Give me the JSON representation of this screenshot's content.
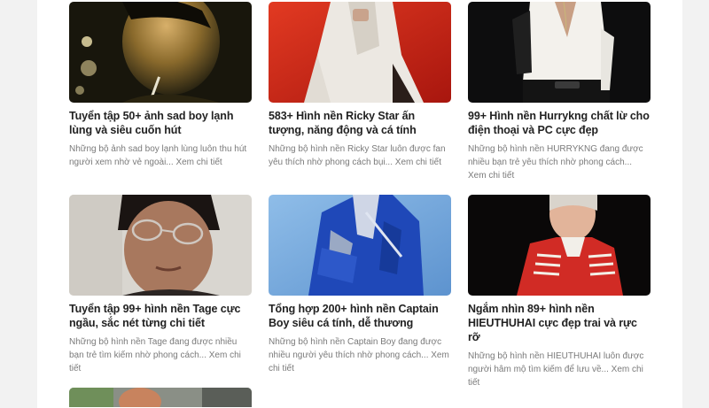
{
  "articles": [
    {
      "title": "Tuyển tập 50+ ảnh sad boy lạnh lùng và siêu cuốn hút",
      "excerpt": "Những bộ ảnh sad boy lạnh lùng luôn thu hút người xem nhờ vẻ ngoài...",
      "more": "Xem chi tiết",
      "image_alt": "sad-boy-portrait"
    },
    {
      "title": "583+ Hình nền Ricky Star ấn tượng, năng động và cá tính",
      "excerpt": "Những bộ hình nền Ricky Star luôn được fan yêu thích nhờ phong cách bụi...",
      "more": "Xem chi tiết",
      "image_alt": "ricky-star-photo"
    },
    {
      "title": "99+ Hình nền Hurrykng chất lừ cho điện thoại và PC cực đẹp",
      "excerpt": "Những bộ hình nền HURRYKNG đang được nhiều bạn trẻ yêu thích nhờ phong cách...",
      "more": "Xem chi tiết",
      "image_alt": "hurrykng-photo"
    },
    {
      "title": "Tuyển tập 99+ hình nền Tage cực ngầu, sắc nét từng chi tiết",
      "excerpt": "Những bộ hình nền Tage đang được nhiều bạn trẻ tìm kiếm nhờ phong cách...",
      "more": "Xem chi tiết",
      "image_alt": "tage-photo"
    },
    {
      "title": "Tổng hợp 200+ hình nền Captain Boy siêu cá tính, dễ thương",
      "excerpt": "Những bộ hình nền Captain Boy đang được nhiều người yêu thích nhờ phong cách...",
      "more": "Xem chi tiết",
      "image_alt": "captain-boy-photo"
    },
    {
      "title": "Ngắm nhìn 89+ hình nền HIEUTHUHAI cực đẹp trai và rực rỡ",
      "excerpt": "Những bộ hình nền HIEUTHUHAI luôn được người hâm mộ tìm kiếm để lưu về...",
      "more": "Xem chi tiết",
      "image_alt": "hieuthuhai-photo"
    }
  ],
  "colors": {
    "title": "#222222",
    "excerpt": "#7a7a7a",
    "page_bg": "#f2f2f2",
    "content_bg": "#ffffff"
  }
}
